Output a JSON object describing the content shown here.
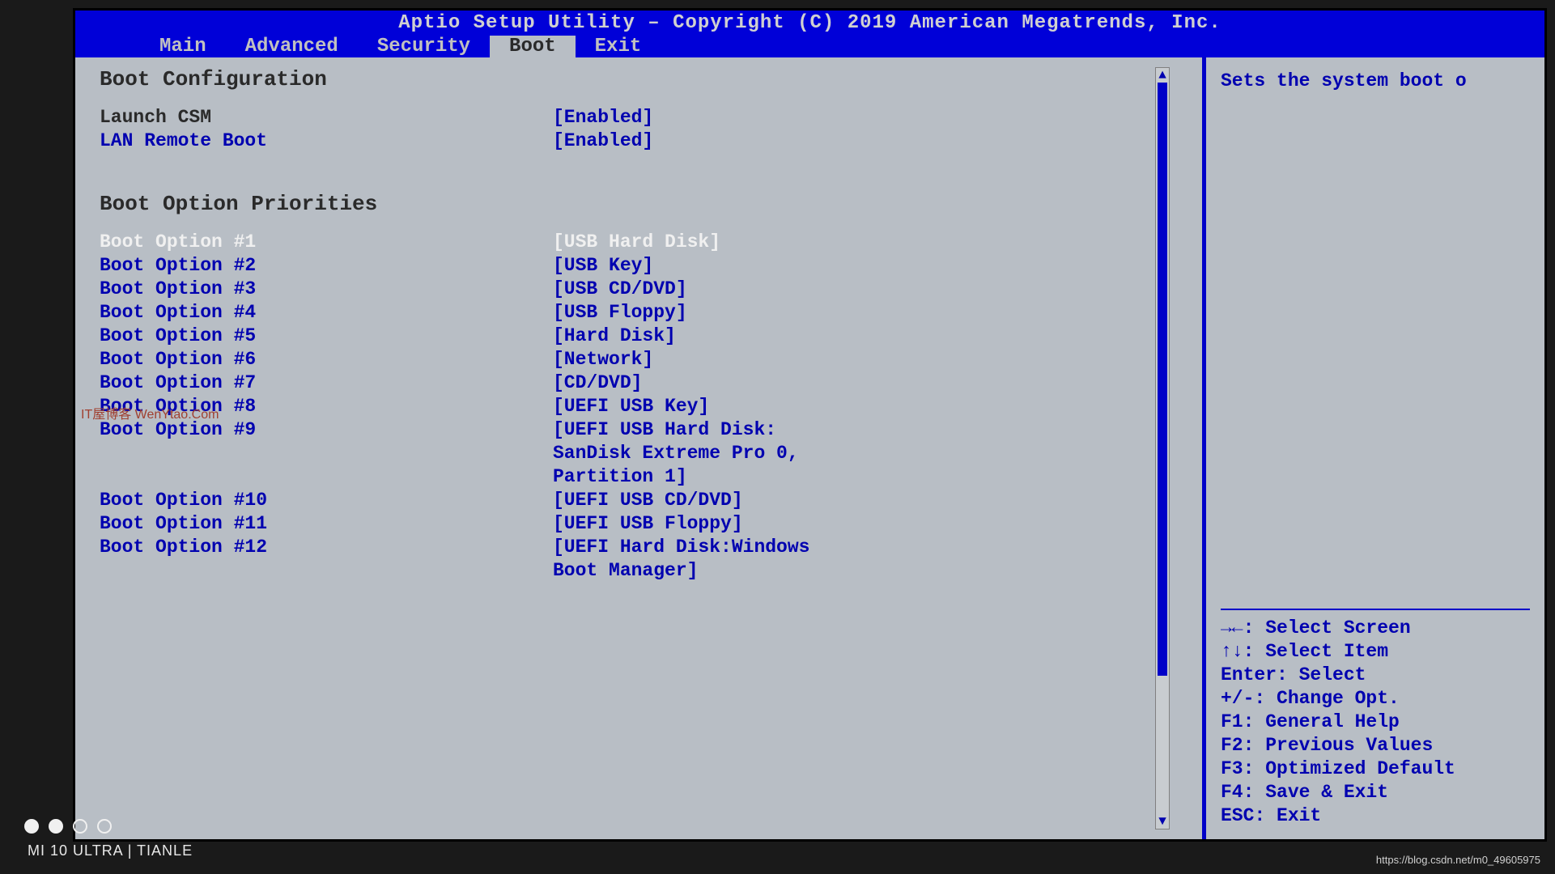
{
  "header": {
    "title": "Aptio Setup Utility – Copyright (C) 2019 American Megatrends, Inc."
  },
  "tabs": [
    {
      "label": "Main",
      "active": false
    },
    {
      "label": "Advanced",
      "active": false
    },
    {
      "label": "Security",
      "active": false
    },
    {
      "label": "Boot",
      "active": true
    },
    {
      "label": "Exit",
      "active": false
    }
  ],
  "main": {
    "section_title": "Boot Configuration",
    "config": [
      {
        "label": "Launch CSM",
        "value": "[Enabled]",
        "dark": true
      },
      {
        "label": "LAN Remote Boot",
        "value": "[Enabled]"
      }
    ],
    "priorities_title": "Boot Option Priorities",
    "options": [
      {
        "label": "Boot Option #1",
        "value": "[USB Hard Disk]",
        "selected": true
      },
      {
        "label": "Boot Option #2",
        "value": "[USB Key]"
      },
      {
        "label": "Boot Option #3",
        "value": "[USB CD/DVD]"
      },
      {
        "label": "Boot Option #4",
        "value": "[USB Floppy]"
      },
      {
        "label": "Boot Option #5",
        "value": "[Hard Disk]"
      },
      {
        "label": "Boot Option #6",
        "value": "[Network]"
      },
      {
        "label": "Boot Option #7",
        "value": "[CD/DVD]"
      },
      {
        "label": "Boot Option #8",
        "value": "[UEFI USB Key]"
      },
      {
        "label": "Boot Option #9",
        "value": "[UEFI USB Hard Disk: SanDisk Extreme Pro 0, Partition 1]"
      },
      {
        "label": "Boot Option #10",
        "value": "[UEFI USB CD/DVD]"
      },
      {
        "label": "Boot Option #11",
        "value": "[UEFI USB Floppy]"
      },
      {
        "label": "Boot Option #12",
        "value": "[UEFI Hard Disk:Windows Boot Manager]"
      }
    ]
  },
  "help": {
    "description": "Sets the system boot o",
    "keys": [
      "→←: Select Screen",
      "↑↓: Select Item",
      "Enter: Select",
      "+/-: Change Opt.",
      "F1: General Help",
      "F2: Previous Values",
      "F3: Optimized Default",
      "F4: Save & Exit",
      "ESC: Exit"
    ]
  },
  "watermarks": {
    "blog": "IT屋博客 WenYtao.Com",
    "phone": "MI 10 ULTRA | TIANLE",
    "url": "https://blog.csdn.net/m0_49605975"
  }
}
